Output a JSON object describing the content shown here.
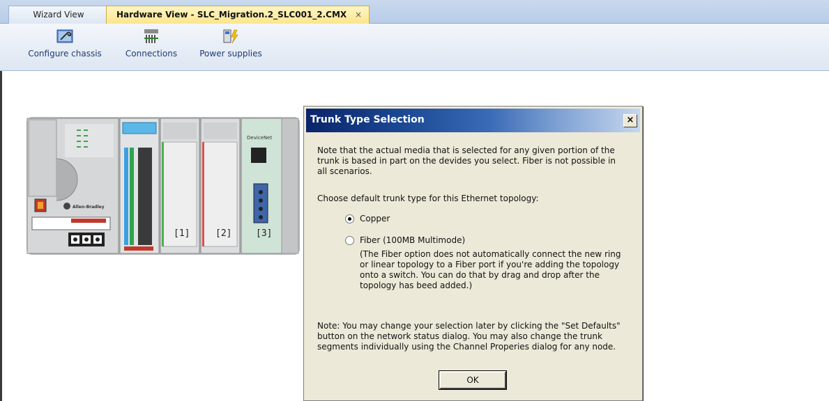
{
  "tabs": [
    {
      "label": "Wizard View",
      "active": false
    },
    {
      "label": "Hardware View - SLC_Migration.2_SLC001_2.CMX",
      "active": true,
      "close": "×"
    }
  ],
  "toolbar": {
    "configure_chassis": {
      "label": "Configure chassis",
      "icon": "wrench-icon"
    },
    "connections": {
      "label": "Connections",
      "icon": "connections-icon"
    },
    "power_supplies": {
      "label": "Power supplies",
      "icon": "power-supply-icon"
    }
  },
  "chassis": {
    "slots": [
      "[1]",
      "[2]",
      "[3]"
    ],
    "vendor": "Allen-Bradley",
    "network_module": "DeviceNet"
  },
  "dialog": {
    "title": "Trunk Type Selection",
    "close": "×",
    "note": "Note that the actual media that is selected for any given portion of the trunk is based in part on the devides you select. Fiber is not possible in all scenarios.",
    "choose": "Choose default trunk type for this Ethernet topology:",
    "options": [
      {
        "label": "Copper",
        "selected": true
      },
      {
        "label": "Fiber (100MB Multimode)",
        "selected": false
      }
    ],
    "fiber_note": "(The Fiber option does not automatically connect the new ring or linear topology to a Fiber port if you're adding the topology onto a switch. You can do that by drag and drop after the topology has beed added.)",
    "note2": "Note: You may change your selection later by clicking the \"Set Defaults\" button on the network status dialog.  You may also change the trunk segments individually using the Channel Properies dialog for any node.",
    "ok": "OK"
  }
}
